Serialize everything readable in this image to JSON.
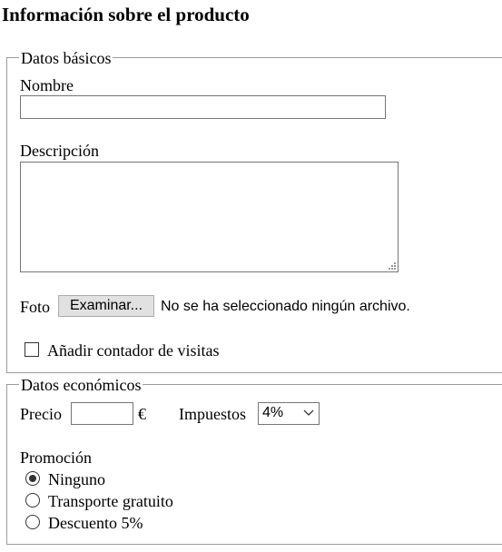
{
  "page_title": "Información sobre el producto",
  "basic": {
    "legend": "Datos básicos",
    "name_label": "Nombre",
    "name_value": "",
    "description_label": "Descripción",
    "description_value": "",
    "photo_label": "Foto",
    "browse_button": "Examinar...",
    "no_file_text": "No se ha seleccionado ningún archivo.",
    "visit_counter_label": "Añadir contador de visitas",
    "visit_counter_checked": false
  },
  "economic": {
    "legend": "Datos económicos",
    "price_label": "Precio",
    "price_value": "",
    "currency": "€",
    "tax_label": "Impuestos",
    "tax_selected": "4%",
    "promotion_label": "Promoción",
    "promotion_options": [
      "Ninguno",
      "Transporte gratuito",
      "Descuento 5%"
    ],
    "promotion_selected": 0
  },
  "icons": {
    "select_arrow": "chevron-down-icon",
    "textarea_resize": "resize-grip-icon"
  }
}
